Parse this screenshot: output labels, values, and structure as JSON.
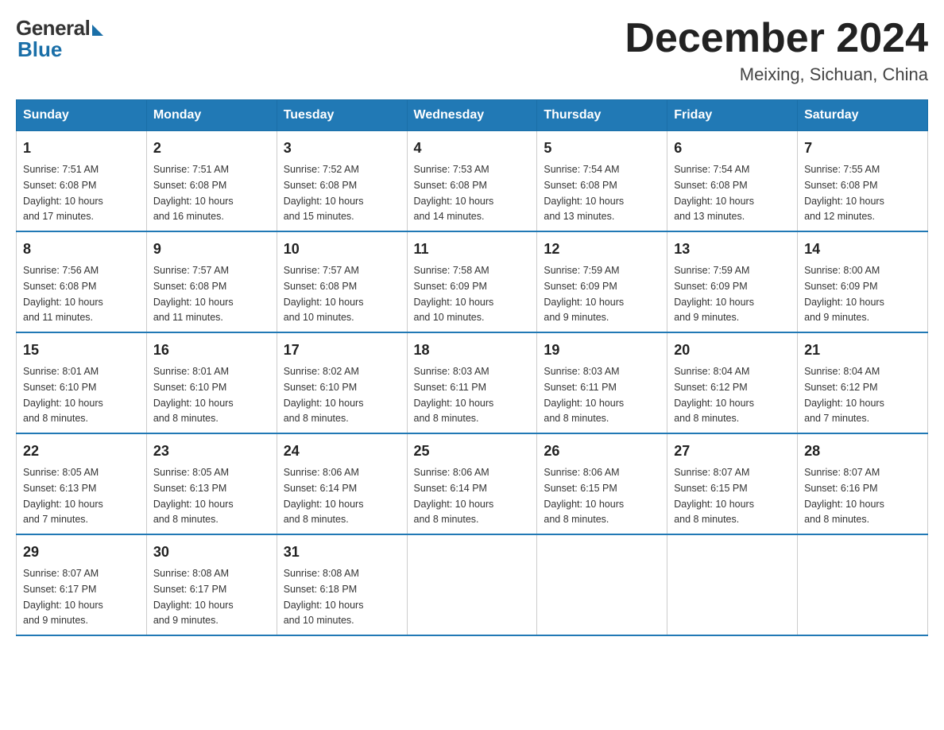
{
  "header": {
    "logo": {
      "general": "General",
      "blue": "Blue"
    },
    "title": "December 2024",
    "location": "Meixing, Sichuan, China"
  },
  "days_of_week": [
    "Sunday",
    "Monday",
    "Tuesday",
    "Wednesday",
    "Thursday",
    "Friday",
    "Saturday"
  ],
  "weeks": [
    [
      {
        "day": "1",
        "sunrise": "7:51 AM",
        "sunset": "6:08 PM",
        "daylight": "10 hours and 17 minutes."
      },
      {
        "day": "2",
        "sunrise": "7:51 AM",
        "sunset": "6:08 PM",
        "daylight": "10 hours and 16 minutes."
      },
      {
        "day": "3",
        "sunrise": "7:52 AM",
        "sunset": "6:08 PM",
        "daylight": "10 hours and 15 minutes."
      },
      {
        "day": "4",
        "sunrise": "7:53 AM",
        "sunset": "6:08 PM",
        "daylight": "10 hours and 14 minutes."
      },
      {
        "day": "5",
        "sunrise": "7:54 AM",
        "sunset": "6:08 PM",
        "daylight": "10 hours and 13 minutes."
      },
      {
        "day": "6",
        "sunrise": "7:54 AM",
        "sunset": "6:08 PM",
        "daylight": "10 hours and 13 minutes."
      },
      {
        "day": "7",
        "sunrise": "7:55 AM",
        "sunset": "6:08 PM",
        "daylight": "10 hours and 12 minutes."
      }
    ],
    [
      {
        "day": "8",
        "sunrise": "7:56 AM",
        "sunset": "6:08 PM",
        "daylight": "10 hours and 11 minutes."
      },
      {
        "day": "9",
        "sunrise": "7:57 AM",
        "sunset": "6:08 PM",
        "daylight": "10 hours and 11 minutes."
      },
      {
        "day": "10",
        "sunrise": "7:57 AM",
        "sunset": "6:08 PM",
        "daylight": "10 hours and 10 minutes."
      },
      {
        "day": "11",
        "sunrise": "7:58 AM",
        "sunset": "6:09 PM",
        "daylight": "10 hours and 10 minutes."
      },
      {
        "day": "12",
        "sunrise": "7:59 AM",
        "sunset": "6:09 PM",
        "daylight": "10 hours and 9 minutes."
      },
      {
        "day": "13",
        "sunrise": "7:59 AM",
        "sunset": "6:09 PM",
        "daylight": "10 hours and 9 minutes."
      },
      {
        "day": "14",
        "sunrise": "8:00 AM",
        "sunset": "6:09 PM",
        "daylight": "10 hours and 9 minutes."
      }
    ],
    [
      {
        "day": "15",
        "sunrise": "8:01 AM",
        "sunset": "6:10 PM",
        "daylight": "10 hours and 8 minutes."
      },
      {
        "day": "16",
        "sunrise": "8:01 AM",
        "sunset": "6:10 PM",
        "daylight": "10 hours and 8 minutes."
      },
      {
        "day": "17",
        "sunrise": "8:02 AM",
        "sunset": "6:10 PM",
        "daylight": "10 hours and 8 minutes."
      },
      {
        "day": "18",
        "sunrise": "8:03 AM",
        "sunset": "6:11 PM",
        "daylight": "10 hours and 8 minutes."
      },
      {
        "day": "19",
        "sunrise": "8:03 AM",
        "sunset": "6:11 PM",
        "daylight": "10 hours and 8 minutes."
      },
      {
        "day": "20",
        "sunrise": "8:04 AM",
        "sunset": "6:12 PM",
        "daylight": "10 hours and 8 minutes."
      },
      {
        "day": "21",
        "sunrise": "8:04 AM",
        "sunset": "6:12 PM",
        "daylight": "10 hours and 7 minutes."
      }
    ],
    [
      {
        "day": "22",
        "sunrise": "8:05 AM",
        "sunset": "6:13 PM",
        "daylight": "10 hours and 7 minutes."
      },
      {
        "day": "23",
        "sunrise": "8:05 AM",
        "sunset": "6:13 PM",
        "daylight": "10 hours and 8 minutes."
      },
      {
        "day": "24",
        "sunrise": "8:06 AM",
        "sunset": "6:14 PM",
        "daylight": "10 hours and 8 minutes."
      },
      {
        "day": "25",
        "sunrise": "8:06 AM",
        "sunset": "6:14 PM",
        "daylight": "10 hours and 8 minutes."
      },
      {
        "day": "26",
        "sunrise": "8:06 AM",
        "sunset": "6:15 PM",
        "daylight": "10 hours and 8 minutes."
      },
      {
        "day": "27",
        "sunrise": "8:07 AM",
        "sunset": "6:15 PM",
        "daylight": "10 hours and 8 minutes."
      },
      {
        "day": "28",
        "sunrise": "8:07 AM",
        "sunset": "6:16 PM",
        "daylight": "10 hours and 8 minutes."
      }
    ],
    [
      {
        "day": "29",
        "sunrise": "8:07 AM",
        "sunset": "6:17 PM",
        "daylight": "10 hours and 9 minutes."
      },
      {
        "day": "30",
        "sunrise": "8:08 AM",
        "sunset": "6:17 PM",
        "daylight": "10 hours and 9 minutes."
      },
      {
        "day": "31",
        "sunrise": "8:08 AM",
        "sunset": "6:18 PM",
        "daylight": "10 hours and 10 minutes."
      },
      null,
      null,
      null,
      null
    ]
  ],
  "labels": {
    "sunrise": "Sunrise:",
    "sunset": "Sunset:",
    "daylight": "Daylight:"
  }
}
